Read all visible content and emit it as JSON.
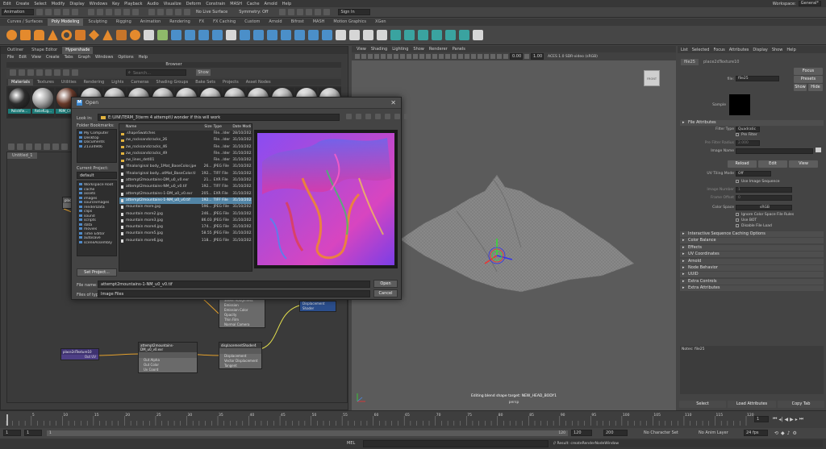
{
  "menubar": [
    "Edit",
    "Create",
    "Select",
    "Modify",
    "Display",
    "Windows",
    "Key",
    "Playback",
    "Audio",
    "Visualize",
    "Deform",
    "Constrain",
    "MASH",
    "Cache",
    "Arnold",
    "Help"
  ],
  "workspace": {
    "label": "Workspace:",
    "value": "General*"
  },
  "status": {
    "mode": "Animation",
    "no_live": "No Live Surface",
    "symmetry": "Symmetry: Off",
    "sign_in": "Sign In"
  },
  "shelf_tabs": [
    "Curves / Surfaces",
    "Poly Modeling",
    "Sculpting",
    "Rigging",
    "Animation",
    "Rendering",
    "FX",
    "FX Caching",
    "Custom",
    "Arnold",
    "Bifrost",
    "MASH",
    "Motion Graphics",
    "XGen"
  ],
  "shelf_active": "Poly Modeling",
  "hypershade": {
    "tabs": [
      "Outliner",
      "Shape Editor",
      "Hypershade"
    ],
    "active_tab": "Hypershade",
    "menu": [
      "File",
      "Edit",
      "View",
      "Create",
      "Tabs",
      "Graph",
      "Windows",
      "Options",
      "Help"
    ],
    "browser_title": "Browser",
    "search_placeholder": "Search...",
    "show_label": "Show",
    "material_tabs": [
      "Materials",
      "Textures",
      "Utilities",
      "Rendering",
      "Lights",
      "Cameras",
      "Shading Groups",
      "Bake Sets",
      "Projects",
      "Asset Nodes"
    ],
    "swatches": [
      {
        "label": "PolishRe...",
        "color": "#2b2b2b"
      },
      {
        "label": "ReliefLig...",
        "color": "#a0a0a0"
      },
      {
        "label": "PBM_Chr...",
        "color": "#6a3a2a"
      },
      {
        "label": "",
        "color": "#c8c8c8"
      },
      {
        "label": "",
        "color": "#c0c0c0"
      },
      {
        "label": "",
        "color": "#b8b8b8"
      },
      {
        "label": "",
        "color": "#bcbcbc"
      },
      {
        "label": "",
        "color": "#c4c4c4"
      },
      {
        "label": "",
        "color": "#c8c8c8"
      },
      {
        "label": "",
        "color": "#bebebe"
      },
      {
        "label": "",
        "color": "#c2c2c2"
      },
      {
        "label": "",
        "color": "#b6b6b6"
      },
      {
        "label": "",
        "color": "#cacaca"
      },
      {
        "label": "",
        "color": "#c0c0c0"
      }
    ],
    "graph_tab": "Untitled_1",
    "nodes": {
      "place2d_a": {
        "title": "place2d"
      },
      "place2d_b": {
        "title": "place2dTexture10",
        "out": "Out UV"
      },
      "file_node": {
        "title": "attempt2mountains-DM_u0_v0.exr",
        "rows": [
          "Out Alpha",
          "Out Color",
          "Uv Coord"
        ]
      },
      "disp_node": {
        "title": "displacementShader4",
        "rows": [
          "Displacement",
          "Vector Displacement",
          "Tangent"
        ]
      },
      "shader_node": {
        "rows": [
          "Sheen Roughness",
          "Emission",
          "Emission Color",
          "Opacity",
          "Thin Film",
          "Normal Camera"
        ]
      },
      "disp_shader": {
        "title": "Displacement Shader"
      }
    }
  },
  "dialog": {
    "title": "Open",
    "look_in_label": "Look in:",
    "look_in_value": "E:\\UNI\\TERM_3\\term 4 attempt\\I wonder if this will work",
    "folder_bookmarks": "Folder Bookmarks:",
    "bookmarks": [
      "My Computer",
      "Desktop",
      "Documents",
      "21334946"
    ],
    "current_project": "Current Project:",
    "project_value": "default",
    "project_folders": [
      "Workspace Root",
      "cache",
      "assets",
      "images",
      "sourceimages",
      "renderData",
      "clips",
      "sound",
      "scripts",
      "data",
      "movies",
      "Time Editor",
      "autosave",
      "sceneAssembly"
    ],
    "set_project": "Set Project...",
    "columns": [
      "Name",
      "Size",
      "Type",
      "Date Modi"
    ],
    "files": [
      {
        "name": ".shapeSwatches",
        "size": "",
        "type": "File...lder",
        "date": "28/10/2022",
        "kind": "folder"
      },
      {
        "name": "zw_rocksandcracks_26",
        "size": "",
        "type": "File...lder",
        "date": "31/10/2022",
        "kind": "folder"
      },
      {
        "name": "zw_rocksandcracks_46",
        "size": "",
        "type": "File...lder",
        "date": "31/10/2022",
        "kind": "folder"
      },
      {
        "name": "zw_rocksandcracks_49",
        "size": "",
        "type": "File...lder",
        "date": "31/10/2022",
        "kind": "folder"
      },
      {
        "name": "zw_lines_detl01",
        "size": "",
        "type": "File...lder",
        "date": "31/10/2022",
        "kind": "folder"
      },
      {
        "name": "!finaloriginal body_1Mat_BaseColor.jpeg",
        "size": "26...",
        "type": "JPEG File",
        "date": "31/10/2022",
        "kind": "file"
      },
      {
        "name": "!finaloriginal body...otMat_BaseColor.tif",
        "size": "192...",
        "type": "TIFF File",
        "date": "31/10/2022",
        "kind": "file"
      },
      {
        "name": "attempt2mountains-DM_u0_v0.exr",
        "size": "21...",
        "type": "EXR File",
        "date": "31/10/2022",
        "kind": "file"
      },
      {
        "name": "attempt2mountains-NM_u0_v0.tif",
        "size": "192...",
        "type": "TIFF File",
        "date": "31/10/2022",
        "kind": "file"
      },
      {
        "name": "attempt2mountains-1-DM_u0_v0.exr",
        "size": "205...",
        "type": "EXR File",
        "date": "31/10/2022",
        "kind": "file"
      },
      {
        "name": "attempt2mountains-1-NM_u0_v0.tif",
        "size": "192...",
        "type": "TIFF File",
        "date": "31/10/2022",
        "kind": "file",
        "selected": true
      },
      {
        "name": "mountain more.jpg",
        "size": "596...",
        "type": "JPEG File",
        "date": "31/10/2022",
        "kind": "file"
      },
      {
        "name": "mountain more2.jpg",
        "size": "246...",
        "type": "JPEG File",
        "date": "31/10/2022",
        "kind": "file"
      },
      {
        "name": "mountain more3.jpg",
        "size": "86.03",
        "type": "JPEG File",
        "date": "31/10/2022",
        "kind": "file"
      },
      {
        "name": "mountain more4.jpg",
        "size": "174...",
        "type": "JPEG File",
        "date": "31/10/2022",
        "kind": "file"
      },
      {
        "name": "mountain more5.jpg",
        "size": "58.55",
        "type": "JPEG File",
        "date": "31/10/2022",
        "kind": "file"
      },
      {
        "name": "mountain more6.jpg",
        "size": "118...",
        "type": "JPEG File",
        "date": "31/10/2022",
        "kind": "file"
      }
    ],
    "file_name_label": "File name:",
    "file_name_value": "attempt2mountains-1-NM_u0_v0.tif",
    "file_type_label": "Files of type:",
    "file_type_value": "Image Files",
    "open_btn": "Open",
    "cancel_btn": "Cancel"
  },
  "viewport": {
    "menu": [
      "View",
      "Shading",
      "Lighting",
      "Show",
      "Renderer",
      "Panels"
    ],
    "cam_value1": "0.00",
    "cam_value2": "1.00",
    "colorspace": "ACES 1.0 SDR-video (sRGB)",
    "cube_label": "FRONT",
    "hud_text": "Editing blend shape target: NEW_HEAD_BODY1",
    "hud_sub": "persp"
  },
  "attr_editor": {
    "menu": [
      "List",
      "Selected",
      "Focus",
      "Attributes",
      "Display",
      "Show",
      "Help"
    ],
    "tabs": [
      "file25",
      "place2dTexture10"
    ],
    "file_label": "file:",
    "file_value": "file25",
    "focus": "Focus",
    "presets": "Presets",
    "show": "Show",
    "hide": "Hide",
    "sample": "Sample",
    "file_attributes": "File Attributes",
    "filter_type_label": "Filter Type",
    "filter_type_value": "Quadratic",
    "pre_filter": "Pre Filter",
    "pre_filter_radius": "Pre Filter Radius",
    "pre_filter_radius_value": "2.000",
    "image_name_label": "Image Name",
    "reload": "Reload",
    "edit": "Edit",
    "view": "View",
    "uv_tiling_label": "UV Tiling Mode",
    "uv_tiling_value": "Off",
    "use_image_seq": "Use Image Sequence",
    "image_number_label": "Image Number",
    "image_number_value": "1",
    "frame_offset_label": "Frame Offset",
    "frame_offset_value": "0",
    "color_space_label": "Color Space",
    "color_space_value": "sRGB",
    "ignore_cs": "Ignore Color Space File Rules",
    "use_bot": "Use BOT",
    "disable_fl": "Disable File Load",
    "sections": [
      "Interactive Sequence Caching Options",
      "Color Balance",
      "Effects",
      "UV Coordinates",
      "Arnold",
      "Node Behavior",
      "UUID",
      "Extra Controls",
      "Extra Attributes"
    ],
    "notes_label": "Notes: file25",
    "select_btn": "Select",
    "load_attr_btn": "Load Attributes",
    "copy_tab_btn": "Copy Tab"
  },
  "timeline": {
    "ticks": [
      "5",
      "10",
      "15",
      "20",
      "25",
      "30",
      "35",
      "40",
      "45",
      "50",
      "55",
      "60",
      "65",
      "70",
      "75",
      "80",
      "85",
      "90",
      "95",
      "100",
      "105",
      "110",
      "115",
      "120"
    ],
    "current_frame": "1",
    "range_start": "1",
    "range_inner_start": "1",
    "range_inner_end": "120",
    "range_end_a": "120",
    "range_end_b": "200",
    "no_char_set": "No Character Set",
    "no_anim_layer": "No Anim Layer",
    "fps": "24 fps"
  },
  "cmdline": {
    "lang": "MEL",
    "result": "// Result: createRenderNodeWindow"
  }
}
